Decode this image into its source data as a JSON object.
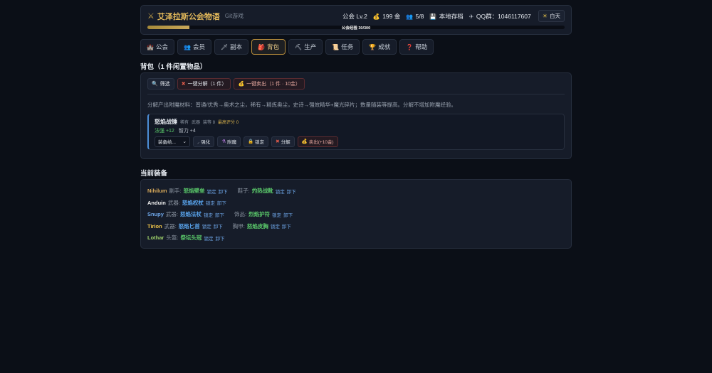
{
  "header": {
    "title_icon": "crossed-swords-icon",
    "title": "艾泽拉斯公会物语",
    "subtitle": "Git游戏",
    "guild_level": "公会 Lv.2",
    "gold": "199 金",
    "members": "5/8",
    "save": "本地存档",
    "qq": "QQ群：1046117607",
    "day_toggle": "白天",
    "xp_label": "公会经验 30/300",
    "xp_progress": 0.1
  },
  "nav": {
    "tabs": [
      {
        "icon": "castle-icon",
        "label": "公会"
      },
      {
        "icon": "users-icon",
        "label": "会员"
      },
      {
        "icon": "sword-icon",
        "label": "副本"
      },
      {
        "icon": "bag-icon",
        "label": "背包"
      },
      {
        "icon": "pickaxe-icon",
        "label": "生产"
      },
      {
        "icon": "scroll-icon",
        "label": "任务"
      },
      {
        "icon": "trophy-icon",
        "label": "成就"
      },
      {
        "icon": "question-icon",
        "label": "帮助"
      }
    ],
    "active_tab": "背包"
  },
  "bag": {
    "title": "背包（1 件闲置物品）",
    "toolbar": {
      "filter": "筛选",
      "salvage_all": "一键分解（1 件）",
      "sell_all": "一键卖出（1 件 · 10金）"
    },
    "description": "分解产出附魔材料：普通/优秀→奥术之尘，稀有→精炼奥尘，史诗→强效精华+魔光碎片；数量随装等提高。分解不增加附魔经验。",
    "item": {
      "name": "怒焰战锤",
      "rarity": "稀有",
      "slot": "武器",
      "ilvl": "装等 8",
      "score": "最高评分 0",
      "stat1": "法强 +12",
      "stat2": "智力 +4",
      "equip_select": "装备给...",
      "actions": {
        "upgrade": "强化",
        "enchant": "附魔",
        "lock": "锁定",
        "salvage": "分解",
        "sell": "卖出(+10金)"
      }
    }
  },
  "equipment": {
    "title": "当前装备",
    "lock_label": "锁定",
    "unequip_label": "卸下",
    "rows": [
      {
        "name": "Nihilum",
        "color": "#d6a85a",
        "items": [
          {
            "slot": "副手:",
            "gear": "怒焰壁垒",
            "quality": "green"
          },
          {
            "slot": "鞋子:",
            "gear": "灼热战靴",
            "quality": "green"
          }
        ]
      },
      {
        "name": "Anduin",
        "color": "#f0f0f0",
        "items": [
          {
            "slot": "武器:",
            "gear": "怒焰权杖",
            "quality": "blue"
          }
        ]
      },
      {
        "name": "Snupy",
        "color": "#6ea6e8",
        "items": [
          {
            "slot": "武器:",
            "gear": "怒焰法杖",
            "quality": "blue"
          },
          {
            "slot": "饰品:",
            "gear": "烈焰护符",
            "quality": "green"
          }
        ]
      },
      {
        "name": "Tirion",
        "color": "#f2c64a",
        "items": [
          {
            "slot": "武器:",
            "gear": "怒焰匕首",
            "quality": "blue"
          },
          {
            "slot": "胸甲:",
            "gear": "怒焰皮胸",
            "quality": "green"
          }
        ]
      },
      {
        "name": "Lothar",
        "color": "#9ed06a",
        "items": [
          {
            "slot": "头盔:",
            "gear": "祭坛头冠",
            "quality": "green"
          }
        ]
      }
    ]
  }
}
